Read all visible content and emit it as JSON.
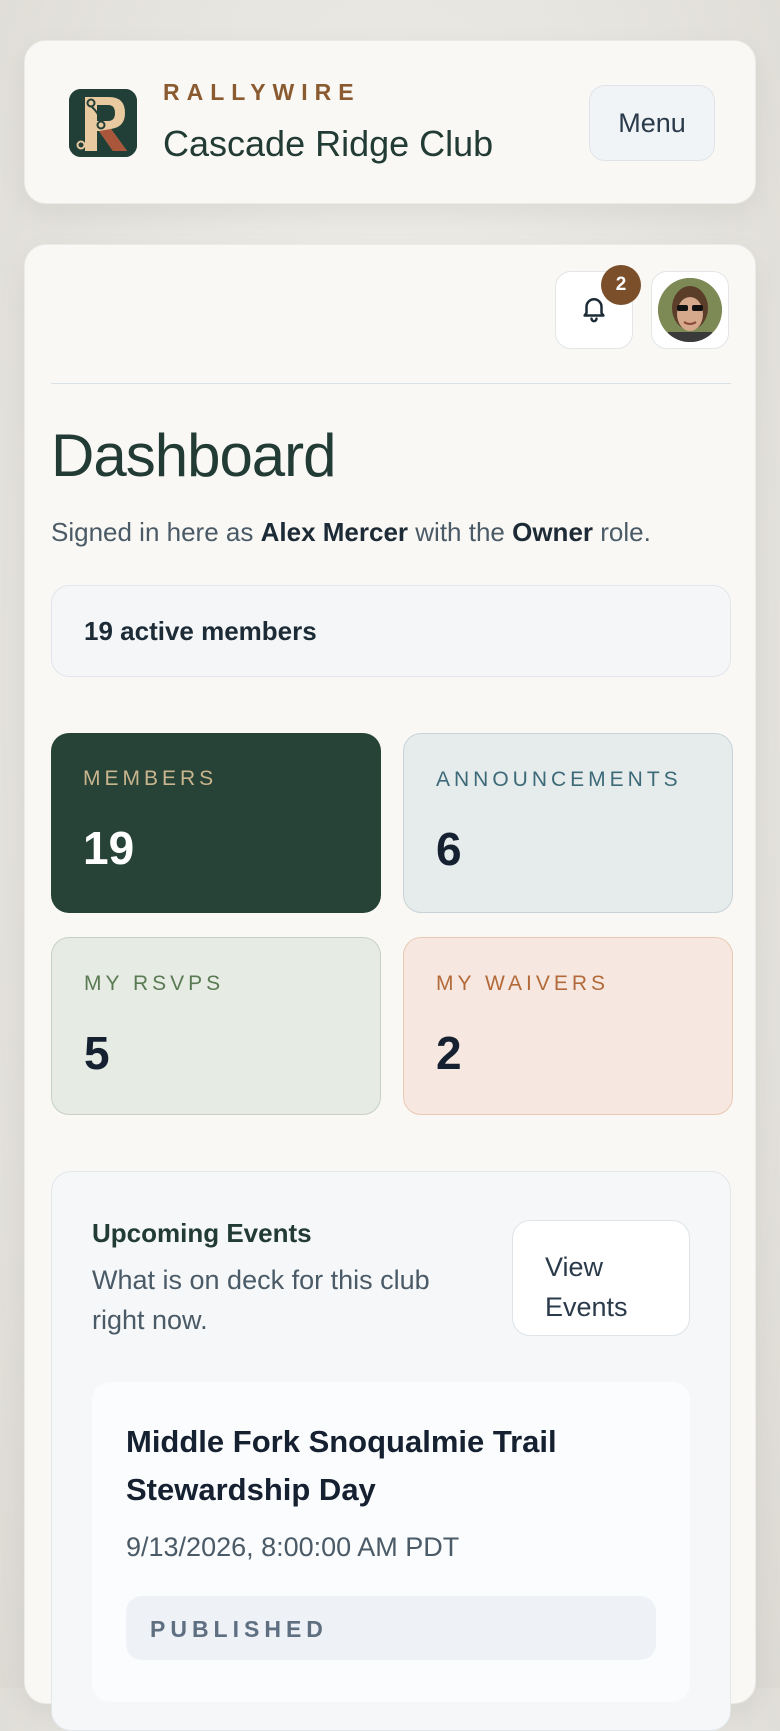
{
  "header": {
    "brand": "RALLYWIRE",
    "club_name": "Cascade Ridge Club",
    "menu_label": "Menu"
  },
  "topbar": {
    "notification_count": "2"
  },
  "main": {
    "title": "Dashboard",
    "signed_in_prefix": "Signed in here as",
    "user_name": "Alex Mercer",
    "signed_in_mid": "with the",
    "role": "Owner",
    "signed_in_suffix": "role.",
    "active_members": "19 active members"
  },
  "stats": [
    {
      "label": "MEMBERS",
      "value": "19"
    },
    {
      "label": "ANNOUNCEMENTS",
      "value": "6"
    },
    {
      "label": "MY RSVPS",
      "value": "5"
    },
    {
      "label": "MY WAIVERS",
      "value": "2"
    }
  ],
  "events": {
    "title": "Upcoming Events",
    "subtitle": "What is on deck for this club right now.",
    "view_label": "View Events",
    "items": [
      {
        "name": "Middle Fork Snoqualmie Trail Stewardship Day",
        "datetime": "9/13/2026, 8:00:00 AM PDT",
        "status": "PUBLISHED"
      }
    ]
  },
  "colors": {
    "brand_accent": "#8a5a30",
    "primary_dark": "#274237",
    "badge": "#7a4f2a"
  },
  "icons": {
    "logo": "rallywire-logo",
    "notifications": "bell-icon",
    "avatar": "user-avatar"
  }
}
